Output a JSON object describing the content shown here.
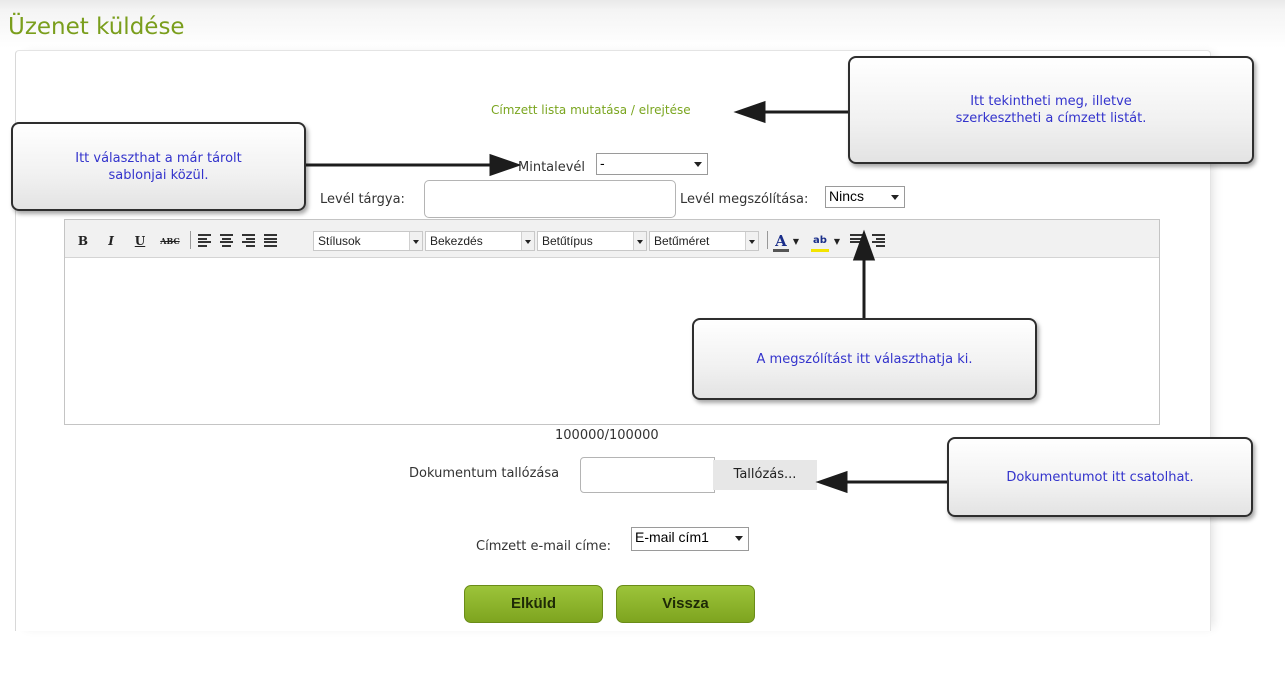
{
  "page": {
    "title": "Üzenet küldése"
  },
  "form": {
    "recipient_toggle": "Címzett lista mutatása / elrejtése",
    "template_label": "Mintalevél",
    "template_value": "-",
    "subject_label": "Levél tárgya:",
    "subject_value": "",
    "salutation_label": "Levél megszólítása:",
    "salutation_value": "Nincs",
    "counter": "100000/100000",
    "document_label": "Dokumentum tallózása",
    "browse_label": "Tallózás...",
    "recipient_email_label": "Címzett e-mail címe:",
    "recipient_email_value": "E-mail cím1",
    "send_label": "Elküld",
    "back_label": "Vissza"
  },
  "toolbar": {
    "bold": "B",
    "italic": "I",
    "underline": "U",
    "strike": "ABC",
    "styles": "Stílusok",
    "paragraph": "Bekezdés",
    "font": "Betűtípus",
    "size": "Betűméret",
    "font_color_glyph": "A",
    "highlight_glyph": "ab",
    "icons": [
      "bold-icon",
      "italic-icon",
      "underline-icon",
      "strikethrough-icon",
      "align-left-icon",
      "align-center-icon",
      "align-right-icon",
      "align-justify-icon",
      "font-color-icon",
      "highlight-color-icon",
      "bulleted-list-icon",
      "numbered-list-icon"
    ]
  },
  "callouts": {
    "recipient_list": "Itt tekintheti meg, illetve szerkesztheti a címzett listát.",
    "template": "Itt választhat a már tárolt sablonjai közül.",
    "salutation": "A megszólítást itt választhatja ki.",
    "document": "Dokumentumot itt csatolhat."
  },
  "colors": {
    "accent": "#7aa51f",
    "callout_text": "#3333cc",
    "button_green": "#8db32b"
  }
}
